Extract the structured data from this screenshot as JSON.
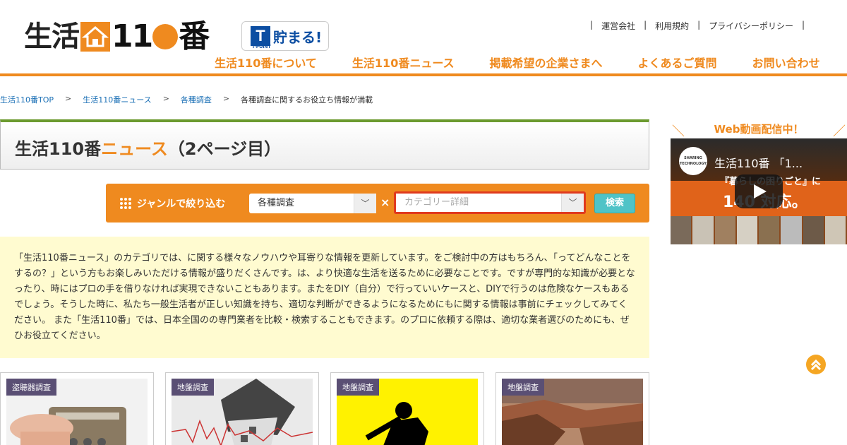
{
  "header": {
    "logo_left": "生活",
    "logo_right_pre": "11",
    "logo_right_post": "番",
    "tpoint_badge": "貯まる!",
    "tpoint_mark": "T",
    "tpoint_sub": "T-POINT",
    "utility_links": [
      "運営会社",
      "利用規約",
      "プライバシーポリシー"
    ],
    "nav": [
      "生活110番について",
      "生活110番ニュース",
      "掲載希望の企業さまへ",
      "よくあるご質問",
      "お問い合わせ"
    ],
    "accent_color": "#ef8a1f"
  },
  "breadcrumb": {
    "items": [
      "生活110番TOP",
      "生活110番ニュース",
      "各種調査"
    ],
    "current": "各種調査に関するお役立ち情報が満載",
    "separator": ">"
  },
  "title": {
    "main": "生活110番",
    "accent": "ニュース",
    "suffix": "（2ページ目）"
  },
  "filter": {
    "label": "ジャンルで絞り込む",
    "genre_value": "各種調査",
    "category_placeholder": "カテゴリー詳細",
    "times": "×",
    "search_label": "検索"
  },
  "description": "「生活110番ニュース」のカテゴリでは、に関する様々なノウハウや耳寄りな情報を更新しています。をご検討中の方はもちろん、「ってどんなことをするの？」という方もお楽しみいただける情報が盛りだくさんです。は、より快適な生活を送るために必要なことです。ですが専門的な知識が必要となったり、時にはプロの手を借りなければ実現できないこともあります。またをDIY（自分）で行っていいケースと、DIYで行うのは危険なケースもあるでしょう。そうした時に、私たち一般生活者が正しい知識を持ち、適切な判断ができるようになるためにもに関する情報は事前にチェックしてみてください。 また「生活110番」では、日本全国のの専門業者を比較・検索することもできます。のプロに依頼する際は、適切な業者選びのためにも、ぜひお役立てください。",
  "cards": [
    {
      "tag": "盗聴器調査"
    },
    {
      "tag": "地盤調査"
    },
    {
      "tag": "地盤調査"
    },
    {
      "tag": "地盤調査"
    }
  ],
  "sidebar": {
    "heading": "Web動画配信中！",
    "video_title": "生活110番 「1...",
    "channel_name": "SHARING TECHNOLOGY",
    "caption1": "『暮らしの困りごと』に",
    "caption2": "140 対応。"
  }
}
